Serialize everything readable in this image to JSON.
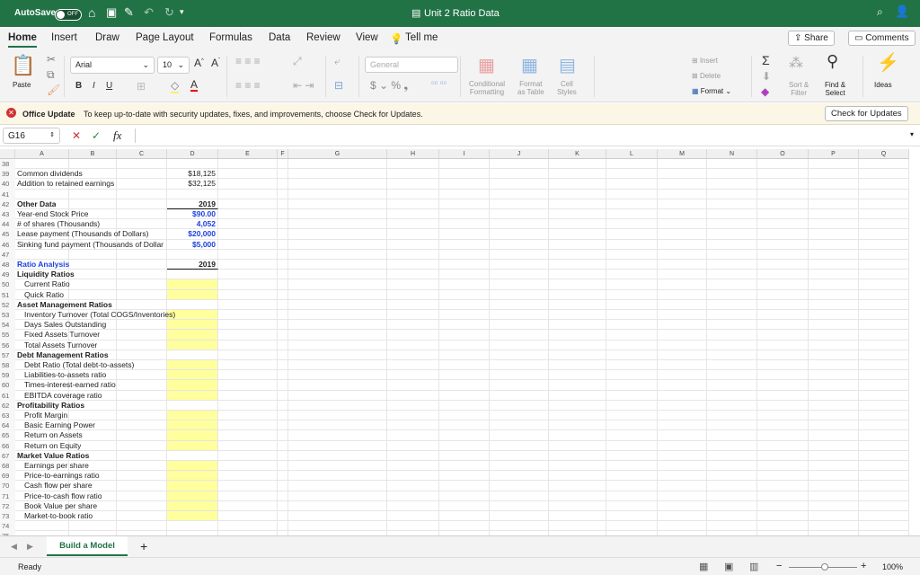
{
  "titlebar": {
    "autosave": "AutoSave",
    "toggle": "OFF",
    "doc_title": "Unit 2 Ratio Data"
  },
  "menu": {
    "tabs": [
      "Home",
      "Insert",
      "Draw",
      "Page Layout",
      "Formulas",
      "Data",
      "Review",
      "View"
    ],
    "tell_me": "Tell me",
    "share": "Share",
    "comments": "Comments"
  },
  "ribbon": {
    "paste": "Paste",
    "font": "Arial",
    "size": "10",
    "number_format": "General",
    "conditional": "Conditional\nFormatting",
    "format_table": "Format\nas Table",
    "cell_styles": "Cell\nStyles",
    "insert": "Insert",
    "delete": "Delete",
    "format": "Format",
    "sort": "Sort &\nFilter",
    "find": "Find &\nSelect",
    "ideas": "Ideas"
  },
  "message": {
    "title": "Office Update",
    "text": "To keep up-to-date with security updates, fixes, and improvements, choose Check for Updates.",
    "button": "Check for Updates"
  },
  "formula_bar": {
    "name_box": "G16",
    "fx": "fx",
    "value": ""
  },
  "columns": [
    "A",
    "B",
    "C",
    "D",
    "E",
    "F",
    "G",
    "H",
    "I",
    "J",
    "K",
    "L",
    "M",
    "N",
    "O",
    "P",
    "Q"
  ],
  "rows": [
    {
      "n": "38",
      "b": "",
      "d": ""
    },
    {
      "n": "39",
      "b": "Common dividends",
      "d": "$18,125"
    },
    {
      "n": "40",
      "b": "Addition to retained earnings",
      "d": "$32,125"
    },
    {
      "n": "41",
      "b": "",
      "d": ""
    },
    {
      "n": "42",
      "b": "Other Data",
      "d": "2019",
      "bs": "bold",
      "ds": "bold ul"
    },
    {
      "n": "43",
      "b": "Year-end Stock Price",
      "d": "$90.00",
      "ds": "bold blue"
    },
    {
      "n": "44",
      "b": "# of shares (Thousands)",
      "d": "4,052",
      "ds": "bold blue"
    },
    {
      "n": "45",
      "b": "Lease payment (Thousands of Dollars)",
      "d": "$20,000",
      "ds": "bold blue"
    },
    {
      "n": "46",
      "b": "Sinking fund payment (Thousands of Dollar",
      "d": "$5,000",
      "ds": "bold blue"
    },
    {
      "n": "47",
      "b": "",
      "d": ""
    },
    {
      "n": "48",
      "b": "Ratio Analysis",
      "d": "2019",
      "bs": "bold blue",
      "ds": "bold ul"
    },
    {
      "n": "49",
      "b": "Liquidity Ratios",
      "d": "",
      "bs": "bold"
    },
    {
      "n": "50",
      "b": "Current Ratio",
      "d": "",
      "bs": "ind",
      "ds": "yel"
    },
    {
      "n": "51",
      "b": "Quick Ratio",
      "d": "",
      "bs": "ind",
      "ds": "yel"
    },
    {
      "n": "52",
      "b": "Asset Management Ratios",
      "d": "",
      "bs": "bold"
    },
    {
      "n": "53",
      "b": "Inventory Turnover (Total COGS/Inventories)",
      "d": "",
      "bs": "ind wide",
      "ds": "yel"
    },
    {
      "n": "54",
      "b": "Days Sales Outstanding",
      "d": "",
      "bs": "ind",
      "ds": "yel"
    },
    {
      "n": "55",
      "b": "Fixed Assets Turnover",
      "d": "",
      "bs": "ind",
      "ds": "yel"
    },
    {
      "n": "56",
      "b": "Total Assets Turnover",
      "d": "",
      "bs": "ind",
      "ds": "yel"
    },
    {
      "n": "57",
      "b": "Debt Management Ratios",
      "d": "",
      "bs": "bold"
    },
    {
      "n": "58",
      "b": "Debt Ratio (Total debt-to-assets)",
      "d": "",
      "bs": "ind",
      "ds": "yel"
    },
    {
      "n": "59",
      "b": "Liabilities-to-assets ratio",
      "d": "",
      "bs": "ind",
      "ds": "yel"
    },
    {
      "n": "60",
      "b": "Times-interest-earned ratio",
      "d": "",
      "bs": "ind",
      "ds": "yel"
    },
    {
      "n": "61",
      "b": "EBITDA coverage ratio",
      "d": "",
      "bs": "ind",
      "ds": "yel"
    },
    {
      "n": "62",
      "b": "Profitability Ratios",
      "d": "",
      "bs": "bold"
    },
    {
      "n": "63",
      "b": "Profit Margin",
      "d": "",
      "bs": "ind",
      "ds": "yel"
    },
    {
      "n": "64",
      "b": "Basic Earning Power",
      "d": "",
      "bs": "ind",
      "ds": "yel"
    },
    {
      "n": "65",
      "b": "Return on Assets",
      "d": "",
      "bs": "ind",
      "ds": "yel"
    },
    {
      "n": "66",
      "b": "Return on Equity",
      "d": "",
      "bs": "ind",
      "ds": "yel"
    },
    {
      "n": "67",
      "b": "Market Value Ratios",
      "d": "",
      "bs": "bold"
    },
    {
      "n": "68",
      "b": "Earnings per share",
      "d": "",
      "bs": "ind",
      "ds": "yel"
    },
    {
      "n": "69",
      "b": "Price-to-earnings ratio",
      "d": "",
      "bs": "ind",
      "ds": "yel"
    },
    {
      "n": "70",
      "b": "Cash flow per share",
      "d": "",
      "bs": "ind",
      "ds": "yel"
    },
    {
      "n": "71",
      "b": "Price-to-cash flow ratio",
      "d": "",
      "bs": "ind",
      "ds": "yel"
    },
    {
      "n": "72",
      "b": "Book Value per share",
      "d": "",
      "bs": "ind",
      "ds": "yel"
    },
    {
      "n": "73",
      "b": "Market-to-book ratio",
      "d": "",
      "bs": "ind",
      "ds": "yel"
    },
    {
      "n": "74",
      "b": "",
      "d": ""
    },
    {
      "n": "75",
      "b": "",
      "d": ""
    }
  ],
  "sheet_tabs": {
    "active": "Build a Model",
    "add": "+"
  },
  "status": {
    "text": "Ready",
    "zoom": "100%"
  },
  "colors": {
    "accent": "#217346",
    "input_blue": "#1b3fe0",
    "highlight": "#ffff9e"
  }
}
